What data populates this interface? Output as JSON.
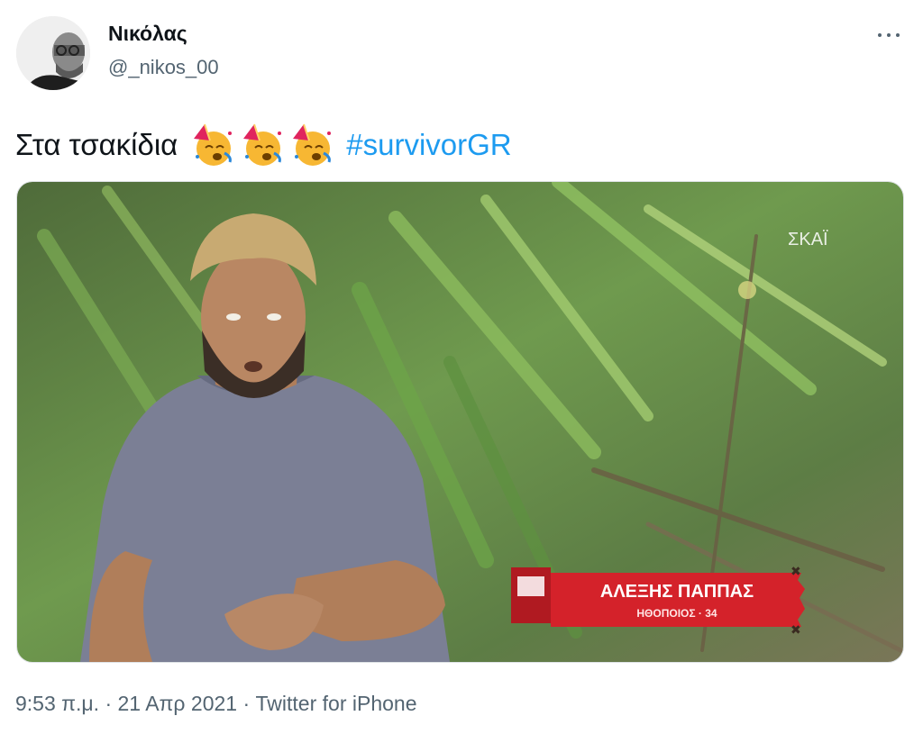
{
  "author": {
    "display_name": "Νικόλας",
    "handle": "@_nikos_00",
    "avatar_icon": "profile-photo"
  },
  "menu": {
    "icon": "more-dots-icon"
  },
  "tweet": {
    "text": "Στα τσακίδια",
    "emojis": [
      "partying-face-emoji",
      "partying-face-emoji",
      "partying-face-emoji"
    ],
    "hashtag": "#survivorGR"
  },
  "media": {
    "channel_logo": "ΣΚΑΪ",
    "caption_name": "ΑΛΕΞΗΣ ΠΑΠΠΑΣ",
    "caption_detail": "ΗΘΟΠΟΙΟΣ · 34",
    "caption_color": "#d4222a"
  },
  "meta": {
    "time": "9:53 π.μ.",
    "separator": " · ",
    "date": "21 Απρ 2021",
    "source": "Twitter for iPhone"
  }
}
